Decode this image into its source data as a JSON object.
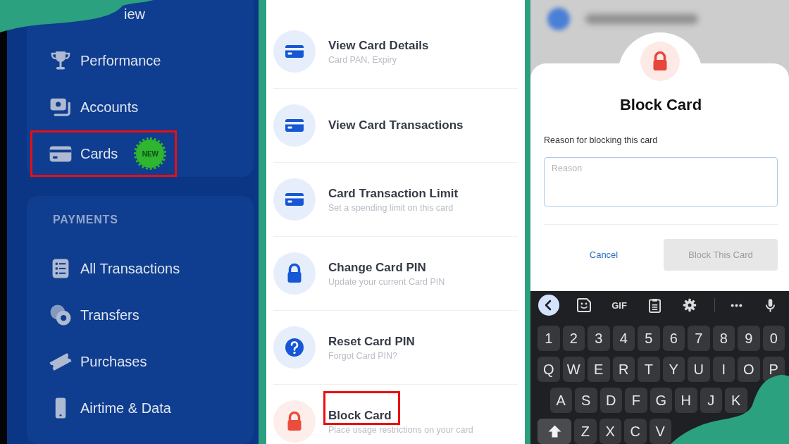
{
  "sidebar": {
    "sections": [
      {
        "clipped_item": "iew",
        "items": [
          {
            "label": "Performance",
            "highlighted": false
          },
          {
            "label": "Accounts",
            "highlighted": false
          },
          {
            "label": "Cards",
            "highlighted": true,
            "badge": "NEW"
          }
        ]
      },
      {
        "heading": "PAYMENTS",
        "items": [
          {
            "label": "All Transactions",
            "highlighted": false
          },
          {
            "label": "Transfers",
            "highlighted": false
          },
          {
            "label": "Purchases",
            "highlighted": false
          },
          {
            "label": "Airtime & Data",
            "highlighted": false
          }
        ]
      }
    ]
  },
  "card_actions": [
    {
      "title": "View Card Details",
      "subtitle": "Card PAN, Expiry",
      "color": "#1557d5",
      "highlighted": false
    },
    {
      "title": "View Card Transactions",
      "color": "#1557d5",
      "highlighted": false
    },
    {
      "title": "Card Transaction Limit",
      "subtitle": "Set a spending limit on this card",
      "color": "#1557d5",
      "highlighted": false
    },
    {
      "title": "Change Card PIN",
      "subtitle": "Update your current Card PIN",
      "color": "#1557d5",
      "highlighted": false
    },
    {
      "title": "Reset Card PIN",
      "subtitle": "Forgot Card PIN?",
      "color": "#1557d5",
      "highlighted": false
    },
    {
      "title": "Block Card",
      "subtitle": "Place usage restrictions on your card",
      "color": "#eb4d3d",
      "highlighted": true
    }
  ],
  "block_dialog": {
    "title": "Block Card",
    "field_label": "Reason for blocking this card",
    "placeholder": "Reason",
    "cancel_label": "Cancel",
    "confirm": {
      "label": "Block This Card",
      "disabled": true
    }
  },
  "keyboard": {
    "gif_label": "GIF",
    "rows": [
      [
        "1",
        "2",
        "3",
        "4",
        "5",
        "6",
        "7",
        "8",
        "9",
        "0"
      ],
      [
        "Q",
        "W",
        "E",
        "R",
        "T",
        "Y",
        "U",
        "I",
        "O",
        "P"
      ],
      [
        "A",
        "S",
        "D",
        "F",
        "G",
        "H",
        "J",
        "K"
      ],
      [
        "Z",
        "X",
        "C",
        "V"
      ]
    ]
  }
}
